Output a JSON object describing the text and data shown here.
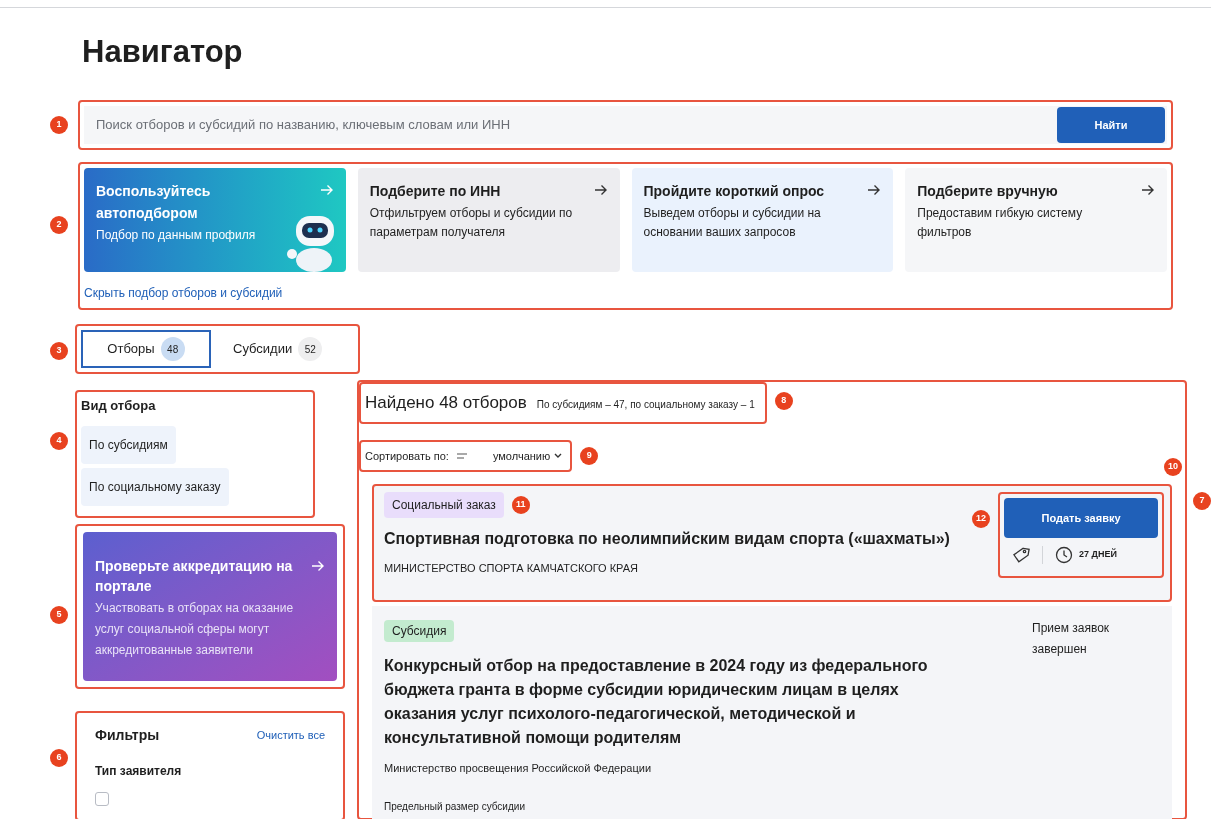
{
  "page": {
    "title": "Навигатор"
  },
  "search": {
    "marker": "1",
    "placeholder": "Поиск отборов и субсидий по названию, ключевым словам или ИНН",
    "button": "Найти"
  },
  "quick": {
    "marker": "2",
    "hide_link": "Скрыть подбор отборов и субсидий",
    "cards": [
      {
        "kind": "promo",
        "title": "Воспользуйтесь автоподбором",
        "text": "Подбор по данным профиля"
      },
      {
        "kind": "gray",
        "title": "Подберите по ИНН",
        "text": "Отфильтруем отборы и субсидии по параметрам получателя"
      },
      {
        "kind": "blue",
        "title": "Пройдите короткий опрос",
        "text": "Выведем отборы и субсидии на основании ваших запросов"
      },
      {
        "kind": "light",
        "title": "Подберите вручную",
        "text": "Предоставим гибкую систему фильтров"
      }
    ]
  },
  "tabs": {
    "marker": "3",
    "items": [
      {
        "label": "Отборы",
        "count": "48",
        "selected": true
      },
      {
        "label": "Субсидии",
        "count": "52",
        "selected": false
      }
    ]
  },
  "type_filter": {
    "marker": "4",
    "title": "Вид отбора",
    "options": [
      "По субсидиям",
      "По социальному заказу"
    ]
  },
  "accreditation": {
    "marker": "5",
    "title": "Проверьте аккредитацию на портале",
    "text": "Участвовать в отборах на оказание услуг социальной сферы могут аккредитованные заявители"
  },
  "filters": {
    "marker": "6",
    "title": "Фильтры",
    "clear": "Очистить все",
    "group": "Тип заявителя",
    "options": [
      {
        "checked": false
      }
    ]
  },
  "results": {
    "marker": "7",
    "found_marker": "8",
    "heading": "Найдено 48 отборов",
    "breakdown": "По субсидиям – 47, по социальному заказу – 1",
    "sort_marker": "9",
    "sort_label": "Сортировать по:",
    "sort_value": "умолчанию",
    "items": [
      {
        "kind": "open",
        "marker": "10",
        "tag_marker": "11",
        "actions_marker": "12",
        "tag": "Социальный заказ",
        "color": "#e9ddfb",
        "title": "Спортивная подготовка по неолимпийским видам спорта («шахматы»)",
        "org": "МИНИСТЕРСТВО СПОРТА КАМЧАТСКОГО КРАЯ",
        "button": "Подать заявку",
        "days": "27 ДНЕЙ"
      },
      {
        "kind": "closed",
        "tag": "Субсидия",
        "color": "#c3ebcf",
        "title": "Конкурсный отбор на предоставление в 2024 году из федерального бюджета гранта в форме субсидии юридическим лицам в целях оказания услуг психолого-педагогической, методической и консультативной помощи родителям",
        "org": "Министерство просвещения Российской Федерации",
        "status": "Прием заявок завершен",
        "amount_label": "Предельный размер субсидии"
      }
    ]
  }
}
